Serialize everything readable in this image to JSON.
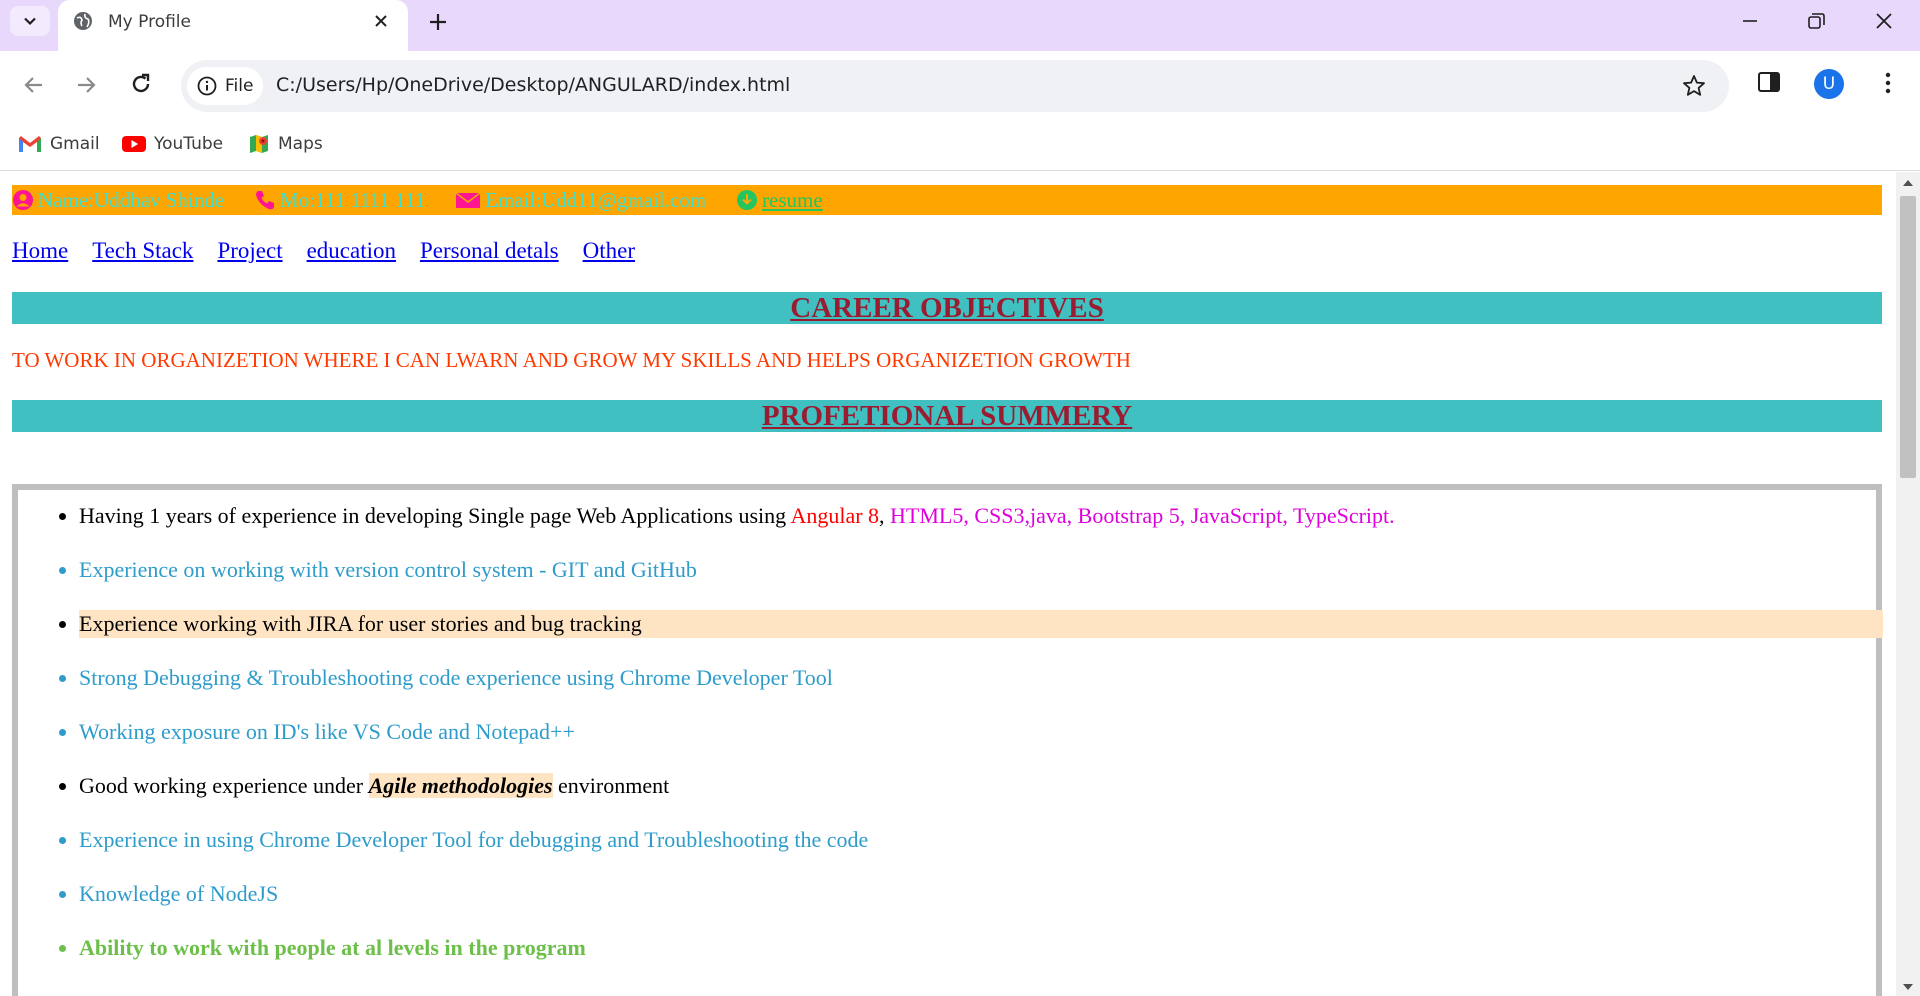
{
  "browser": {
    "tab_title": "My Profile",
    "site_chip_label": "File",
    "url": "C:/Users/Hp/OneDrive/Desktop/ANGULARD/index.html",
    "avatar_letter": "U",
    "bookmarks": [
      "Gmail",
      "YouTube",
      "Maps"
    ]
  },
  "header": {
    "name": "Name:Uddhav Shinde",
    "mobile": "Mo:111 1111 111",
    "email": "Email:Udd11@gmail.com",
    "resume": "resume"
  },
  "nav": [
    "Home",
    "Tech Stack",
    "Project",
    "education",
    "Personal detals",
    "Other"
  ],
  "career": {
    "heading": "CAREER OBJECTIVES",
    "text": "TO WORK IN ORGANIZETION WHERE I CAN LWARN AND GROW MY SKILLS AND HELPS ORGANIZETION GROWTH"
  },
  "summary": {
    "heading": "PROFETIONAL SUMMERY",
    "item1": {
      "prefix": "Having 1 years of experience in developing Single page Web Applications using ",
      "angular": "Angular 8",
      "comma": ",",
      "tech": " HTML5, CSS3,java, Bootstrap 5, JavaScript, TypeScript."
    },
    "item2": "Experience on working with version control system - GIT and GitHub",
    "item3": "Experience working with JIRA for user stories and bug tracking",
    "item4": "Strong Debugging & Troubleshooting code experience using Chrome Developer Tool",
    "item5": "Working exposure on ID's like VS Code and Notepad++",
    "item6": {
      "prefix": "Good working experience under ",
      "agile": "Agile methodologies",
      "suffix": " environment"
    },
    "item7": "Experience in using Chrome Developer Tool for debugging and Troubleshooting the code",
    "item8": "Knowledge of NodeJS",
    "item9": "Ability to work with people at al levels in the program"
  },
  "colors": {
    "contact_bar": "#ffa500",
    "contact_text": "#40e0d0",
    "section_head_bg": "#40c0c0",
    "section_head_text": "#9b1c31",
    "objective_text": "#ff3a00",
    "teal_item": "#2e9cca",
    "green_item": "#6cc04a",
    "highlight": "#ffe4c4"
  }
}
